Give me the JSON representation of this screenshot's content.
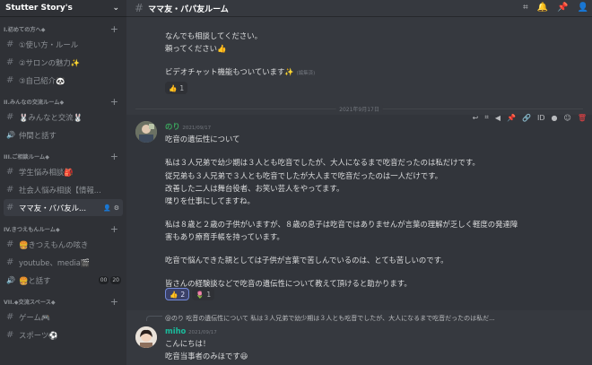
{
  "server": {
    "name": "Stutter Story's"
  },
  "sidebar": {
    "categories": [
      {
        "label": "I.初めての方へ◆",
        "channels": [
          {
            "name": "①使い方・ルール"
          },
          {
            "name": "②サロンの魅力✨"
          },
          {
            "name": "③自己紹介🐼"
          }
        ]
      },
      {
        "label": "II.みんなの交流ルーム◆",
        "channels": [
          {
            "name": "🐰みんなと交流🐰"
          },
          {
            "name": "仲間と話す",
            "voice": true
          }
        ]
      },
      {
        "label": "III.ご相談ルーム◆",
        "channels": [
          {
            "name": "学生悩み相談🎒"
          },
          {
            "name": "社会人悩み相談【情報..."
          },
          {
            "name": "ママ友・パパ友ル...",
            "active": true
          }
        ]
      },
      {
        "label": "IV.きつえもんルーム◆",
        "channels": [
          {
            "name": "🍔きつえもんの呟き"
          },
          {
            "name": "youtube、media🎬"
          },
          {
            "name": "🍔と話す",
            "voice": true,
            "counts": [
              "00",
              "20"
            ]
          }
        ]
      },
      {
        "label": "VII.◆交流スペース◆",
        "channels": [
          {
            "name": "ゲーム🎮"
          },
          {
            "name": "スポーツ⚽"
          }
        ]
      }
    ]
  },
  "channel": {
    "title": "ママ友・パパ友ルーム"
  },
  "messages": {
    "prev_lines": [
      "なんでも相談してください。",
      "頼ってください👍"
    ],
    "video_line": "ビデオチャット機能もついています✨",
    "edited": "(編集済)",
    "prev_reaction": {
      "emoji": "👍",
      "count": "1"
    },
    "date_divider": "2021年9月17日",
    "nori": {
      "username": "のり",
      "timestamp": "2021/09/17",
      "lines": [
        "吃音の遺伝性について",
        "私は３人兄弟で幼少期は３人とも吃音でしたが、大人になるまで吃音だったのは私だけです。",
        "従兄弟も３人兄弟で３人とも吃音でしたが大人まで吃音だったのは一人だけです。",
        "改善した二人は舞台役者、お笑い芸人をやってます。",
        "喋りを仕事にしてますね。",
        "私は８歳と２歳の子供がいますが、８歳の息子は吃音ではありませんが言葉の理解が乏しく軽度の発達障",
        "害もあり療育手帳を持っています。",
        "吃音で悩んできた親としては子供が言葉で苦しんでいるのは、とても苦しいのです。",
        "皆さんの経験談などで吃音の遺伝性について教えて頂けると助かります。"
      ],
      "reactions": [
        {
          "emoji": "👍",
          "count": "2",
          "me": true
        },
        {
          "emoji": "🌷",
          "count": "1",
          "me": false
        }
      ]
    },
    "reply_preview": "@のり 吃音の遺伝性について 私は３人兄弟で幼少期は３人とも吃音でしたが、大人になるまで吃音だったのは私だ...",
    "miho": {
      "username": "miho",
      "timestamp": "2021/09/17",
      "lines": [
        "こんにちは！",
        "吃音当事者のみほです😆"
      ]
    }
  },
  "colors": {
    "nori": "#3ba55d",
    "miho": "#1abc9c",
    "accent": "#7289da"
  }
}
